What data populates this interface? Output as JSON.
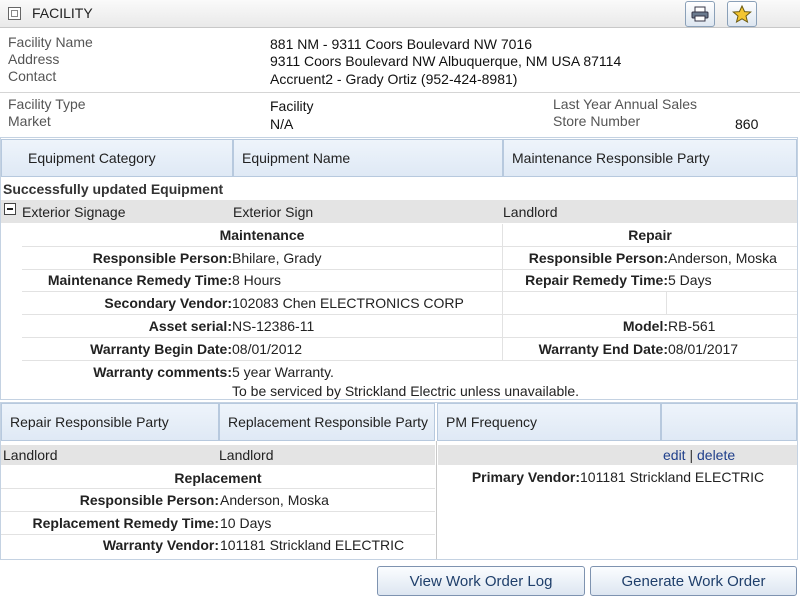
{
  "facility": {
    "section_title": "FACILITY",
    "name_label": "Facility Name",
    "name_value": "881 NM - 9311 Coors Boulevard NW 7016",
    "address_label": "Address",
    "address_value": "9311 Coors Boulevard NW Albuquerque, NM USA 87114",
    "contact_label": "Contact",
    "contact_value": "Accruent2 - Grady Ortiz (952-424-8981)",
    "type_label": "Facility Type",
    "type_value": "Facility",
    "market_label": "Market",
    "market_value": "N/A",
    "sales_label": "Last Year Annual Sales",
    "sales_value": "",
    "store_label": "Store Number",
    "store_value": "860"
  },
  "equipment": {
    "headers": [
      "Equipment Category",
      "Equipment Name",
      "Maintenance Responsible Party"
    ],
    "success_message": "Successfully updated Equipment",
    "row": {
      "category": "Exterior Signage",
      "name": "Exterior Sign",
      "party": "Landlord"
    },
    "maintenance": {
      "title": "Maintenance",
      "responsible_label": "Responsible Person:",
      "responsible_value": "Bhilare, Grady",
      "remedy_label": "Maintenance Remedy Time:",
      "remedy_value": "8 Hours",
      "secondary_vendor_label": "Secondary Vendor:",
      "secondary_vendor_value": "102083 Chen ELECTRONICS CORP",
      "asset_serial_label": "Asset serial:",
      "asset_serial_value": "NS-12386-11",
      "warranty_begin_label": "Warranty Begin Date:",
      "warranty_begin_value": "08/01/2012",
      "warranty_comments_label": "Warranty comments:",
      "warranty_comments_line1": "5 year Warranty.",
      "warranty_comments_line2": "To be serviced by Strickland Electric unless unavailable."
    },
    "repair": {
      "title": "Repair",
      "responsible_label": "Responsible Person:",
      "responsible_value": "Anderson, Moska",
      "remedy_label": "Repair Remedy Time:",
      "remedy_value": "5 Days",
      "model_label": "Model:",
      "model_value": "RB-561",
      "warranty_end_label": "Warranty End Date:",
      "warranty_end_value": "08/01/2017"
    }
  },
  "lower": {
    "headers": [
      "Repair Responsible Party",
      "Replacement Responsible Party",
      "PM Frequency"
    ],
    "repair_party": "Landlord",
    "replacement_party": "Landlord",
    "edit_label": "edit",
    "divider": "|",
    "delete_label": "delete",
    "replacement": {
      "title": "Replacement",
      "responsible_label": "Responsible Person:",
      "responsible_value": "Anderson, Moska",
      "remedy_label": "Replacement Remedy Time:",
      "remedy_value": "10 Days",
      "warranty_vendor_label": "Warranty Vendor:",
      "warranty_vendor_value": "101181 Strickland ELECTRIC"
    },
    "primary_vendor_label": "Primary Vendor:",
    "primary_vendor_value": "101181 Strickland ELECTRIC"
  },
  "buttons": {
    "view_log": "View Work Order Log",
    "generate": "Generate Work Order"
  },
  "icons": {
    "collapse": "collapse-square-icon",
    "minus": "minus-square-icon",
    "print": "printer-icon",
    "favorite": "star-icon"
  },
  "colors": {
    "header_bg": "#e9e9e9",
    "column_header_bg": "#dfe9f5",
    "row_grey": "#e4e4e4",
    "link": "#1f3f8b",
    "button_text": "#1f3f6b"
  }
}
